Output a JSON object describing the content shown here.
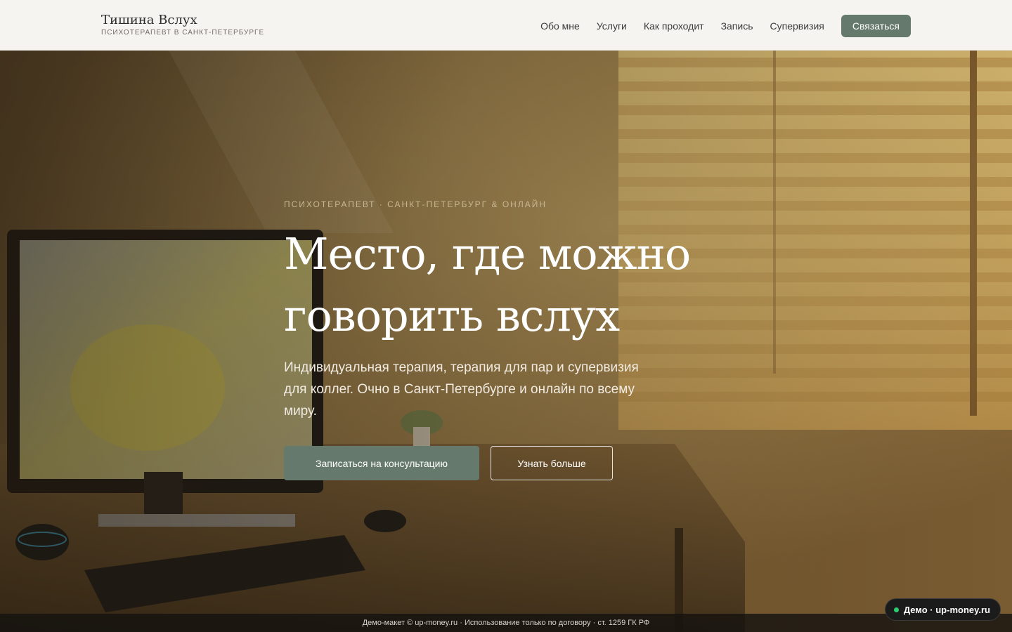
{
  "brand": {
    "name": "Тишина Вслух",
    "tagline": "ПСИХОТЕРАПЕВТ В САНКТ-ПЕТЕРБУРГЕ"
  },
  "nav": {
    "items": [
      {
        "label": "Обо мне"
      },
      {
        "label": "Услуги"
      },
      {
        "label": "Как проходит"
      },
      {
        "label": "Запись"
      },
      {
        "label": "Супервизия"
      }
    ],
    "cta_label": "Связаться"
  },
  "hero": {
    "eyebrow": "ПСИХОТЕРАПЕВТ · САНКТ-ПЕТЕРБУРГ & ОНЛАЙН",
    "title_line1": "Место, где можно",
    "title_line2": "говорить вслух",
    "lead": "Индивидуальная терапия, терапия для пар и супервизия для коллег. Очно в Санкт-Петербурге и онлайн по всему миру.",
    "primary_button": "Записаться на консультацию",
    "secondary_button": "Узнать больше"
  },
  "footer": {
    "text": "Демо-макет © up-money.ru · Использование только по договору · ст. 1259 ГК РФ"
  },
  "demo_badge": {
    "label": "Демо · up-money.ru"
  },
  "colors": {
    "accent": "#65796c",
    "header_bg": "#f6f4f0",
    "eyebrow": "#c9b792"
  }
}
